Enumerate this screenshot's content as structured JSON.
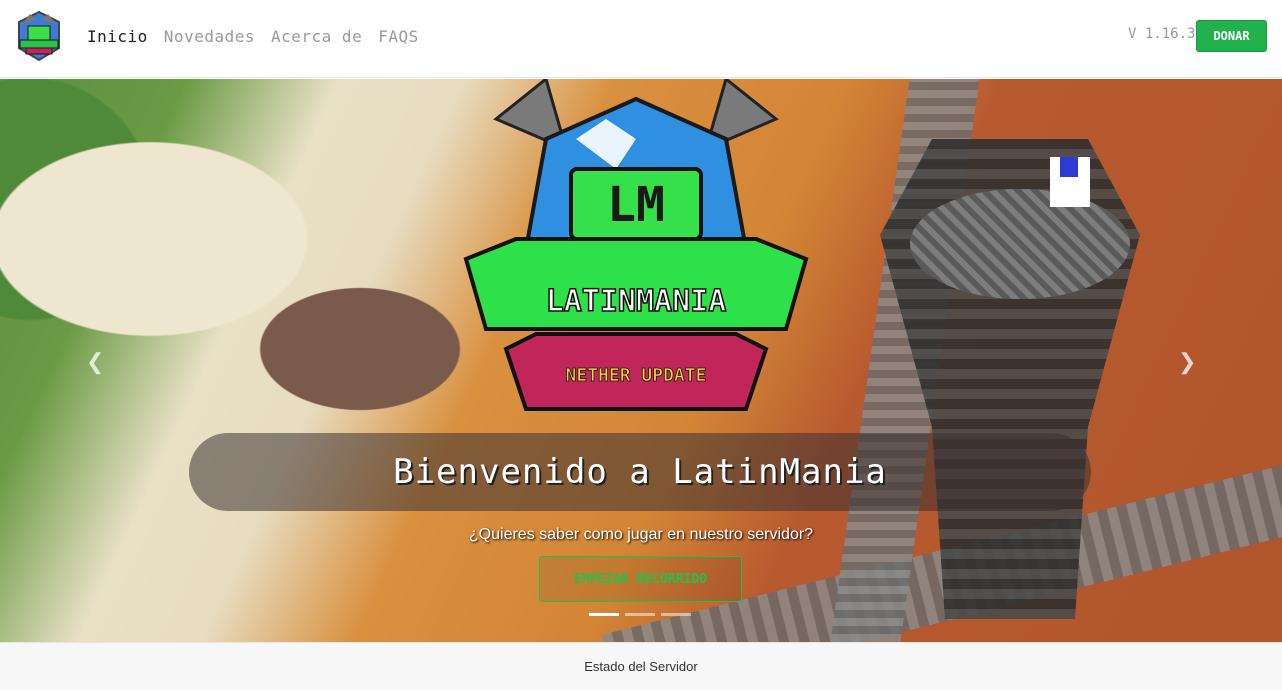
{
  "header": {
    "nav": [
      {
        "label": "Inicio",
        "active": true
      },
      {
        "label": "Novedades",
        "active": false
      },
      {
        "label": "Acerca de",
        "active": false
      },
      {
        "label": "FAQS",
        "active": false
      }
    ],
    "version": "V 1.16.3",
    "donate_label": "DONAR",
    "accent_color": "#22b14c"
  },
  "hero": {
    "logo_text": "LM",
    "logo_banner": "LATINMANIA",
    "logo_subbanner": "NETHER UPDATE",
    "title": "Bienvenido a LatinMania",
    "subtitle": "¿Quieres saber como jugar en nuestro servidor?",
    "cta_label": "EMPEZAR RECORRIDO",
    "slides": 3,
    "active_slide": 1
  },
  "status": {
    "label": "Estado del Servidor"
  },
  "icons": {
    "prev": "chevron-left-icon",
    "next": "chevron-right-icon"
  }
}
